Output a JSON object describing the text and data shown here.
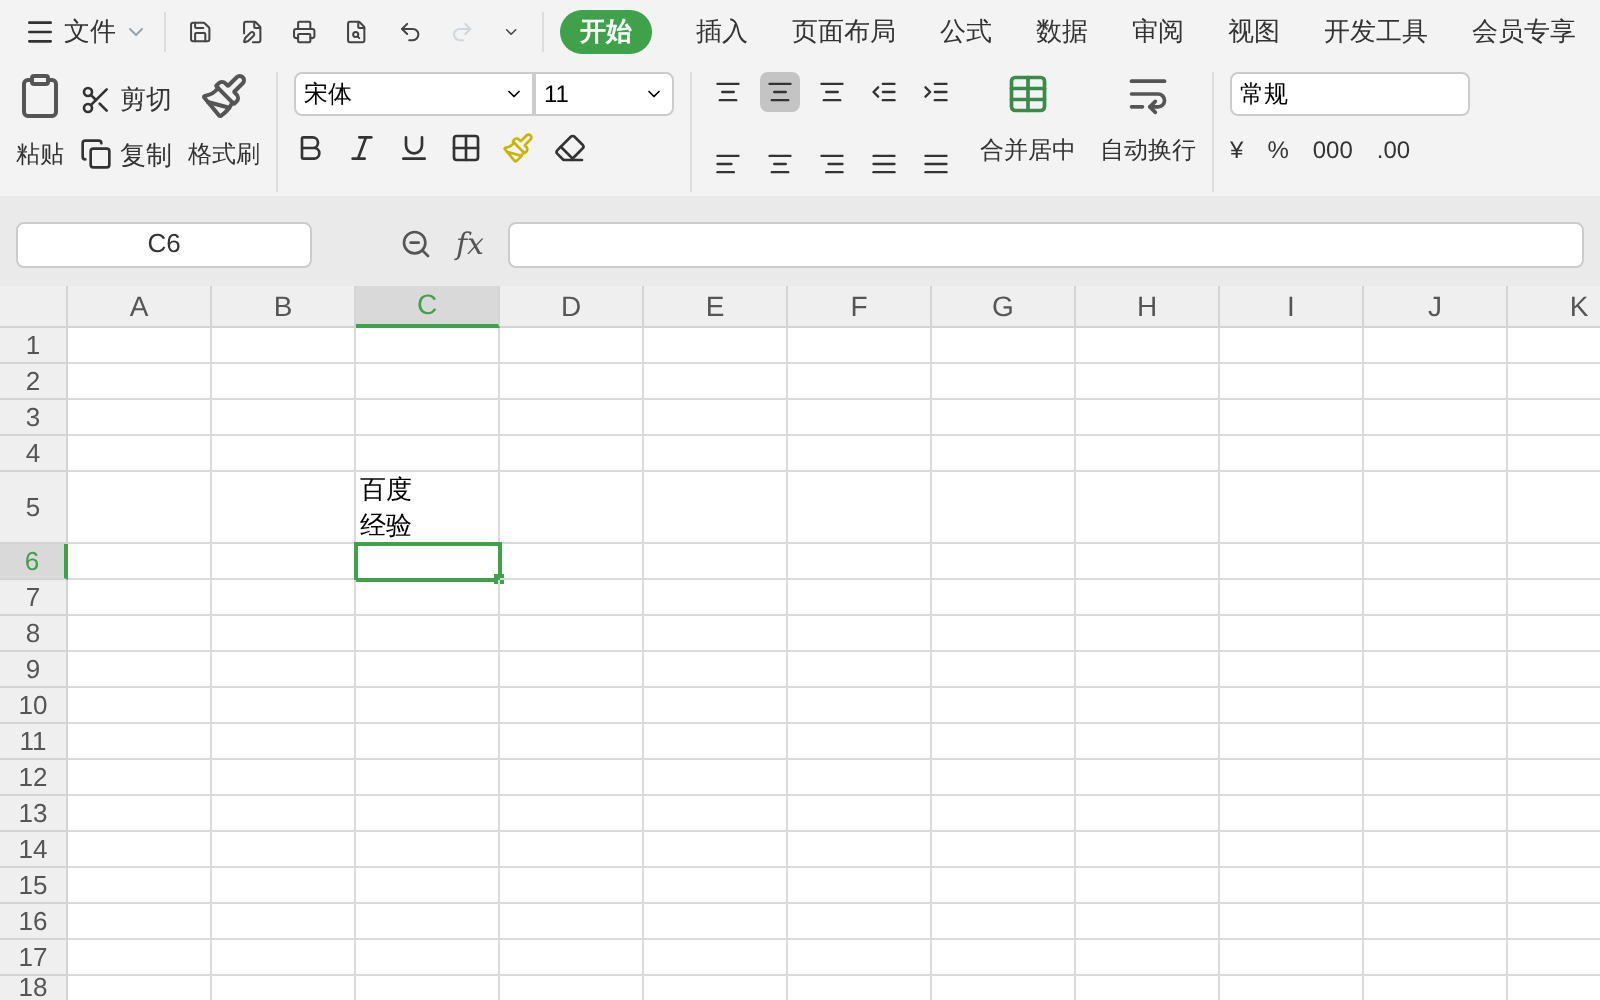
{
  "menu": {
    "label": "文件"
  },
  "quick_access": {
    "redo_enabled": false
  },
  "tabs": [
    {
      "label": "开始",
      "selected": true
    },
    {
      "label": "插入",
      "selected": false
    },
    {
      "label": "页面布局",
      "selected": false
    },
    {
      "label": "公式",
      "selected": false
    },
    {
      "label": "数据",
      "selected": false
    },
    {
      "label": "审阅",
      "selected": false
    },
    {
      "label": "视图",
      "selected": false
    },
    {
      "label": "开发工具",
      "selected": false
    },
    {
      "label": "会员专享",
      "selected": false
    }
  ],
  "clipboard": {
    "paste": "粘贴",
    "cut": "剪切",
    "copy": "复制",
    "format_painter": "格式刷"
  },
  "font": {
    "name": "宋体",
    "size": "11"
  },
  "alignment": [
    {
      "kind": "top",
      "selected": false
    },
    {
      "kind": "middle",
      "selected": true
    },
    {
      "kind": "bottom",
      "selected": false
    },
    {
      "kind": "outdent",
      "selected": false
    },
    {
      "kind": "indent",
      "selected": false
    },
    {
      "kind": "left",
      "selected": false
    },
    {
      "kind": "center",
      "selected": false
    },
    {
      "kind": "right",
      "selected": false
    },
    {
      "kind": "justify",
      "selected": false
    },
    {
      "kind": "distribute",
      "selected": false
    }
  ],
  "merge": "合并居中",
  "wrap": "自动换行",
  "number": {
    "format": "常规",
    "symbols": [
      "¥",
      "%",
      "000",
      ".00"
    ]
  },
  "formula_bar": {
    "name_box": "C6",
    "fx": "fx"
  },
  "columns": [
    {
      "label": "A",
      "selected": false
    },
    {
      "label": "B",
      "selected": false
    },
    {
      "label": "C",
      "selected": true
    },
    {
      "label": "D",
      "selected": false
    },
    {
      "label": "E",
      "selected": false
    },
    {
      "label": "F",
      "selected": false
    },
    {
      "label": "G",
      "selected": false
    },
    {
      "label": "H",
      "selected": false
    },
    {
      "label": "I",
      "selected": false
    },
    {
      "label": "J",
      "selected": false
    },
    {
      "label": "K",
      "selected": false
    }
  ],
  "rows": [
    {
      "label": "1",
      "selected": false
    },
    {
      "label": "2",
      "selected": false
    },
    {
      "label": "3",
      "selected": false
    },
    {
      "label": "4",
      "selected": false
    },
    {
      "label": "5",
      "selected": false,
      "cells": [
        null,
        null,
        {
          "lines": [
            "百度",
            "经验"
          ]
        }
      ]
    },
    {
      "label": "6",
      "selected": true
    },
    {
      "label": "7",
      "selected": false
    },
    {
      "label": "8",
      "selected": false
    },
    {
      "label": "9",
      "selected": false
    },
    {
      "label": "10",
      "selected": false
    },
    {
      "label": "11",
      "selected": false
    },
    {
      "label": "12",
      "selected": false
    },
    {
      "label": "13",
      "selected": false
    },
    {
      "label": "14",
      "selected": false
    },
    {
      "label": "15",
      "selected": false
    },
    {
      "label": "16",
      "selected": false
    },
    {
      "label": "17",
      "selected": false
    },
    {
      "label": "18",
      "selected": false
    }
  ]
}
